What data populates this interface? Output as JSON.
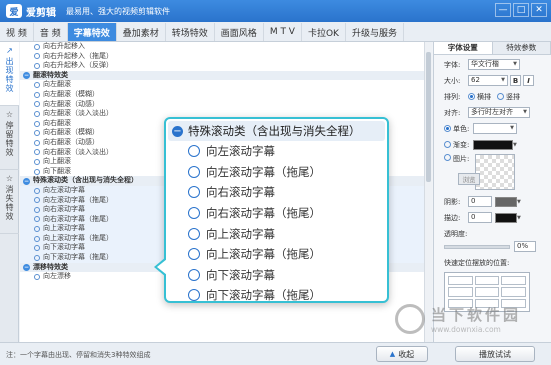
{
  "app": {
    "title": "爱剪辑",
    "slogan": "最易用、强大的视频剪辑软件",
    "logo_char": "爱"
  },
  "window_buttons": [
    "—",
    "□",
    "✕"
  ],
  "menu": [
    "视 频",
    "音 频",
    "字幕特效",
    "叠加素材",
    "转场特效",
    "画面风格",
    "M T V",
    "卡拉OK",
    "升级与服务"
  ],
  "side_tabs": [
    {
      "icon": "↗",
      "label": "出现特效"
    },
    {
      "icon": "☆",
      "label": "停留特效"
    },
    {
      "icon": "☆",
      "label": "消失特效"
    }
  ],
  "tree": [
    {
      "type": "item",
      "text": "向右升起移入"
    },
    {
      "type": "item",
      "text": "向右升起移入（拖尾）"
    },
    {
      "type": "item",
      "text": "向右升起移入（反弹）"
    },
    {
      "type": "cat",
      "text": "翻滚特效类"
    },
    {
      "type": "item",
      "text": "向左翻滚"
    },
    {
      "type": "item",
      "text": "向左翻滚（模糊）"
    },
    {
      "type": "item",
      "text": "向左翻滚（动感）"
    },
    {
      "type": "item",
      "text": "向左翻滚（淡入淡出）"
    },
    {
      "type": "item",
      "text": "向右翻滚"
    },
    {
      "type": "item",
      "text": "向右翻滚（模糊）"
    },
    {
      "type": "item",
      "text": "向右翻滚（动感）"
    },
    {
      "type": "item",
      "text": "向右翻滚（淡入淡出）"
    },
    {
      "type": "item",
      "text": "向上翻滚"
    },
    {
      "type": "item",
      "text": "向下翻滚"
    },
    {
      "type": "cat",
      "text": "特殊滚动类（含出现与消失全程）"
    },
    {
      "type": "item",
      "text": "向左滚动字幕"
    },
    {
      "type": "item",
      "text": "向左滚动字幕（拖尾）"
    },
    {
      "type": "item",
      "text": "向右滚动字幕"
    },
    {
      "type": "item",
      "text": "向右滚动字幕（拖尾）"
    },
    {
      "type": "item",
      "text": "向上滚动字幕"
    },
    {
      "type": "item",
      "text": "向上滚动字幕（拖尾）"
    },
    {
      "type": "item",
      "text": "向下滚动字幕"
    },
    {
      "type": "item",
      "text": "向下滚动字幕（拖尾）"
    },
    {
      "type": "cat",
      "text": "漂移特效类"
    },
    {
      "type": "item",
      "text": "向左漂移"
    }
  ],
  "popup": {
    "header": "特殊滚动类（含出现与消失全程）",
    "items": [
      "向左滚动字幕",
      "向左滚动字幕（拖尾）",
      "向右滚动字幕",
      "向右滚动字幕（拖尾）",
      "向上滚动字幕",
      "向上滚动字幕（拖尾）",
      "向下滚动字幕",
      "向下滚动字幕（拖尾）"
    ]
  },
  "props": {
    "tabs": [
      "字体设置",
      "特效参数"
    ],
    "font_label": "字体:",
    "font_value": "华文行楷",
    "size_label": "大小:",
    "size_value": "62",
    "bold": "B",
    "italic": "I",
    "layout_label": "排列:",
    "horizontal": "横排",
    "vertical": "竖排",
    "align_label": "对齐:",
    "align_value": "多行时左对齐",
    "solid_label": "单色:",
    "gradient_label": "渐变:",
    "image_label": "图片:",
    "browse": "浏览",
    "shadow_label": "阴影:",
    "shadow_value": "0",
    "stroke_label": "描边:",
    "stroke_value": "0",
    "opacity_label": "透明度:",
    "opacity_value": "0%",
    "position_label": "快速定位摆放的位置:"
  },
  "bottom": {
    "note": "注：一个字幕由出现、停留和消失3种特效组成",
    "collapse_icon": "▲",
    "collapse": "收起",
    "play": "播放试试"
  },
  "watermark": {
    "big": "当下软件园",
    "small": "www.downxia.com"
  },
  "colors": {
    "accent": "#2a73cc",
    "popup_border": "#36c0d4"
  }
}
